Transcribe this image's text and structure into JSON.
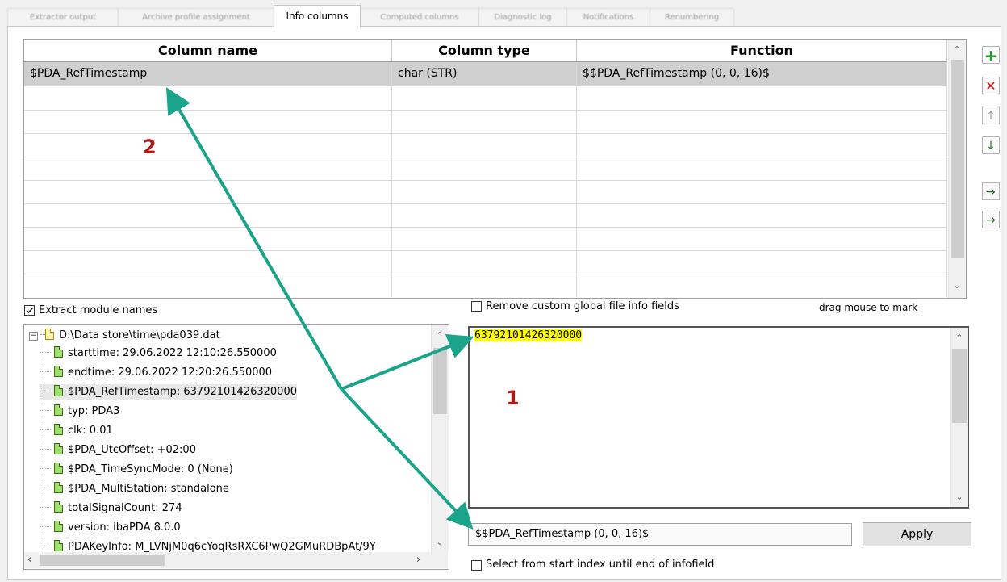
{
  "tabs": [
    {
      "label": "Extractor output",
      "active": false
    },
    {
      "label": "Archive profile assignment",
      "active": false
    },
    {
      "label": "Info columns",
      "active": true
    },
    {
      "label": "Computed columns",
      "active": false
    },
    {
      "label": "Diagnostic log",
      "active": false
    },
    {
      "label": "Notifications",
      "active": false
    },
    {
      "label": "Renumbering",
      "active": false
    }
  ],
  "grid": {
    "headers": [
      "Column name",
      "Column type",
      "Function"
    ],
    "rows": [
      {
        "name": "$PDA_RefTimestamp",
        "type": "char (STR)",
        "function": "$$PDA_RefTimestamp (0, 0, 16)$"
      }
    ]
  },
  "toolbar": {
    "add": "+",
    "delete": "✕",
    "move_up": "↑",
    "move_down": "↓",
    "import": "→",
    "export": "→"
  },
  "extract_module_names": {
    "label": "Extract module names",
    "checked": true
  },
  "remove_custom": {
    "label": "Remove custom global file info fields",
    "checked": false
  },
  "drag_hint": "drag mouse to mark",
  "tree": {
    "root": "D:\\Data store\\time\\pda039.dat",
    "items": [
      "starttime: 29.06.2022 12:10:26.550000",
      "endtime: 29.06.2022 12:20:26.550000",
      "$PDA_RefTimestamp: 63792101426320000",
      "typ: PDA3",
      "clk: 0.01",
      "$PDA_UtcOffset: +02:00",
      "$PDA_TimeSyncMode: 0 (None)",
      "$PDA_MultiStation: standalone",
      "totalSignalCount: 274",
      "version: ibaPDA 8.0.0",
      "PDAKeyInfo: M_LVNjM0q6cYoqRsRXC6PwQ2GMuRDBpAt/9Y"
    ]
  },
  "info_value": "63792101426320000",
  "function_field": "$$PDA_RefTimestamp (0, 0, 16)$",
  "apply_label": "Apply",
  "select_from_start": {
    "label": "Select from start index until end of infofield",
    "checked": false
  },
  "annotations": {
    "one": "1",
    "two": "2"
  },
  "colors": {
    "arrow": "#1aa58a",
    "annotation": "#b01818",
    "highlight": "#ffff00"
  }
}
